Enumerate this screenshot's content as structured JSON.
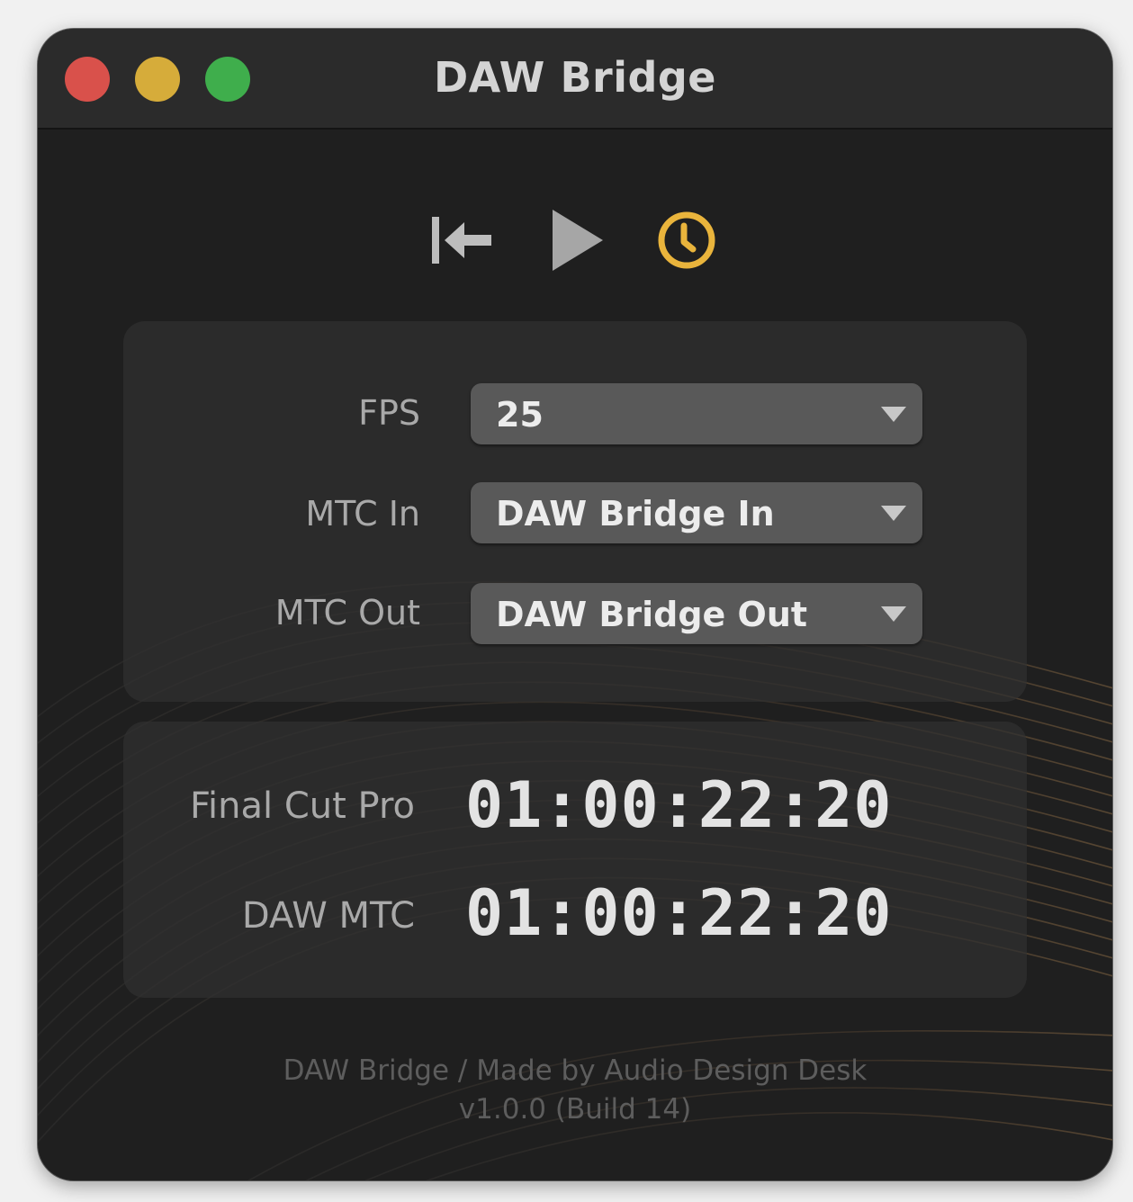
{
  "window": {
    "title": "DAW Bridge"
  },
  "titlebar": {
    "buttons": [
      "close",
      "minimize",
      "zoom"
    ]
  },
  "toolbar": {
    "rewind_icon": "rewind-to-start-icon",
    "play_icon": "play-icon",
    "clock_icon": "clock-icon",
    "clock_color": "#e9b43c"
  },
  "settings": {
    "fps": {
      "label": "FPS",
      "value": "25"
    },
    "mtc_in": {
      "label": "MTC In",
      "value": "DAW Bridge In"
    },
    "mtc_out": {
      "label": "MTC Out",
      "value": "DAW Bridge Out"
    }
  },
  "timecodes": {
    "final_cut_pro": {
      "label": "Final Cut Pro",
      "value": "01:00:22:20"
    },
    "daw_mtc": {
      "label": "DAW MTC",
      "value": "01:00:22:20"
    }
  },
  "footer": {
    "credit": "DAW Bridge / Made by Audio Design Desk",
    "version": "v1.0.0 (Build 14)"
  }
}
